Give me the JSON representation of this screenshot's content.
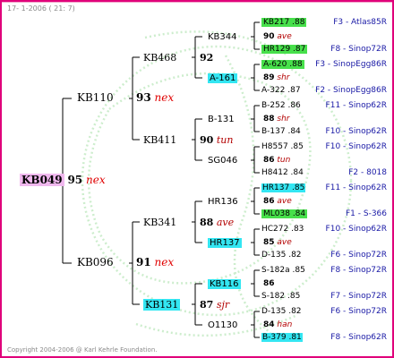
{
  "header": "17- 1-2006 ( 21: 7)",
  "copyright": "Copyright 2004-2006 @ Karl Kehrle Foundation.",
  "root": {
    "name": "KB049",
    "num": "95",
    "tag": "nex"
  },
  "gen1": [
    {
      "name": "KB110",
      "num": "93",
      "tag": "nex"
    },
    {
      "name": "KB096",
      "num": "91",
      "tag": "nex"
    }
  ],
  "gen2": [
    {
      "name": "KB468",
      "num": "92",
      "tag": ""
    },
    {
      "name": "KB411",
      "num": "90",
      "tag": "tun"
    },
    {
      "name": "KB341",
      "num": "88",
      "tag": "ave"
    },
    {
      "name": "KB131",
      "num": "87",
      "tag": "sjr"
    }
  ],
  "gen3": [
    {
      "name": "KB344",
      "num": "90",
      "tag": "ave"
    },
    {
      "name": "A-161",
      "num": "89",
      "tag": "shr"
    },
    {
      "name": "B-131",
      "num": "88",
      "tag": "shr"
    },
    {
      "name": "SG046",
      "num": "86",
      "tag": "tun"
    },
    {
      "name": "HR136",
      "num": "86",
      "tag": "ave"
    },
    {
      "name": "HR137",
      "num": "85",
      "tag": "ave"
    },
    {
      "name": "KB116",
      "num": "86",
      "tag": ""
    },
    {
      "name": "O1130",
      "num": "84",
      "tag": "han"
    }
  ],
  "gen4": [
    {
      "name": "KB217 .88",
      "desc": "F3 - Atlas85R"
    },
    {
      "name": "HR129 .87",
      "desc": "F8 - Sinop72R"
    },
    {
      "name": "A-620 .88",
      "desc": "F3 - SinopEgg86R"
    },
    {
      "name": "A-322 .87",
      "desc": "F2 - SinopEgg86R"
    },
    {
      "name": "B-252 .86",
      "desc": "F11 - Sinop62R"
    },
    {
      "name": "B-137 .84",
      "desc": "F10 - Sinop62R"
    },
    {
      "name": "H8557 .85",
      "desc": "F10 - Sinop62R"
    },
    {
      "name": "H8412 .84",
      "desc": "F2 - 8018"
    },
    {
      "name": "HR137 .85",
      "desc": "F11 - Sinop62R"
    },
    {
      "name": "ML038 .84",
      "desc": "F1 - S-366"
    },
    {
      "name": "HC272 .83",
      "desc": "F10 - Sinop62R"
    },
    {
      "name": "D-135 .82",
      "desc": "F6 - Sinop72R"
    },
    {
      "name": "S-182a .85",
      "desc": "F8 - Sinop72R"
    },
    {
      "name": "S-182 .85",
      "desc": "F7 - Sinop72R"
    },
    {
      "name": "D-135 .82",
      "desc": "F6 - Sinop72R"
    },
    {
      "name": "B-379 .81",
      "desc": "F8 - Sinop62R"
    }
  ],
  "colors": {
    "border": "#e0007a",
    "root_bg": "#f0b8ee",
    "cyan": "#33e6f2",
    "green": "#47e04b",
    "nex": "#e00000",
    "tag": "#b30000",
    "desc": "#1a1aa6"
  }
}
